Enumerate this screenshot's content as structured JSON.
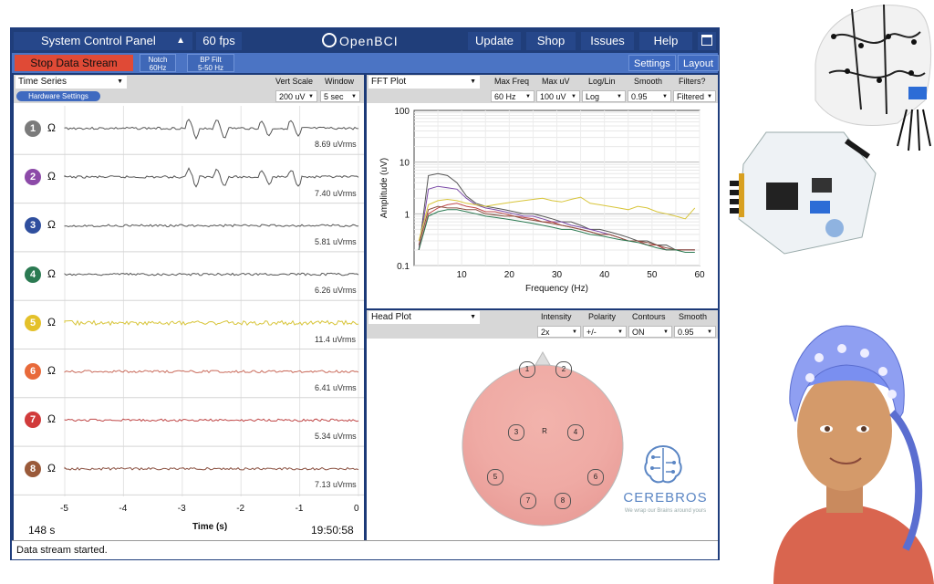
{
  "topbar": {
    "panel_label": "System Control Panel",
    "fps": "60 fps",
    "logo": "OpenBCI",
    "menu": [
      "Update",
      "Shop",
      "Issues",
      "Help"
    ]
  },
  "subbar": {
    "stop_label": "Stop Data Stream",
    "notch_l1": "Notch",
    "notch_l2": "60Hz",
    "bp_l1": "BP Filt",
    "bp_l2": "5-50 Hz",
    "settings": "Settings",
    "layout": "Layout"
  },
  "timeseries": {
    "title": "Time Series",
    "hw_settings": "Hardware Settings",
    "vert_scale_label": "Vert Scale",
    "window_label": "Window",
    "vert_scale": "200 uV",
    "window": "5 sec",
    "channels": [
      {
        "num": "1",
        "color": "#7b7b7b",
        "rms": "8.69 uVrms",
        "trace": "#555555"
      },
      {
        "num": "2",
        "color": "#8c4aa8",
        "rms": "7.40 uVrms",
        "trace": "#555555"
      },
      {
        "num": "3",
        "color": "#2f4f9e",
        "rms": "5.81 uVrms",
        "trace": "#555555"
      },
      {
        "num": "4",
        "color": "#2b7a52",
        "rms": "6.26 uVrms",
        "trace": "#555555"
      },
      {
        "num": "5",
        "color": "#e4c12a",
        "rms": "11.4 uVrms",
        "trace": "#d8c53a"
      },
      {
        "num": "6",
        "color": "#e86a3a",
        "rms": "6.41 uVrms",
        "trace": "#c96a5a"
      },
      {
        "num": "7",
        "color": "#d13b3b",
        "rms": "5.34 uVrms",
        "trace": "#c04848"
      },
      {
        "num": "8",
        "color": "#9a5a3a",
        "rms": "7.13 uVrms",
        "trace": "#8a5040"
      }
    ],
    "x_ticks": [
      "-5",
      "-4",
      "-3",
      "-2",
      "-1",
      "0"
    ],
    "x_label": "Time (s)",
    "elapsed": "148 s",
    "clock": "19:50:58"
  },
  "fft": {
    "title": "FFT Plot",
    "labels": [
      "Max Freq",
      "Max uV",
      "Log/Lin",
      "Smooth",
      "Filters?"
    ],
    "values": [
      "60 Hz",
      "100 uV",
      "Log",
      "0.95",
      "Filtered"
    ],
    "chart_data": {
      "type": "line",
      "x_label": "Frequency (Hz)",
      "y_label": "Amplitude (uV)",
      "x_ticks": [
        "10",
        "20",
        "30",
        "40",
        "50",
        "60"
      ],
      "y_ticks": [
        "100",
        "10",
        "1",
        "0.1"
      ],
      "xlim": [
        0,
        60
      ],
      "ylim": [
        0.1,
        100
      ],
      "y_scale": "log",
      "x": [
        1,
        3,
        5,
        7,
        9,
        11,
        13,
        15,
        17,
        19,
        21,
        23,
        25,
        27,
        29,
        31,
        33,
        35,
        37,
        39,
        41,
        43,
        45,
        47,
        49,
        51,
        53,
        55,
        57,
        59
      ],
      "series": [
        {
          "color": "#555555",
          "values": [
            0.2,
            5.5,
            6,
            5.5,
            4,
            2.2,
            1.6,
            1.4,
            1.3,
            1.2,
            1.1,
            1,
            1,
            0.9,
            0.8,
            0.7,
            0.7,
            0.6,
            0.5,
            0.5,
            0.45,
            0.4,
            0.35,
            0.3,
            0.3,
            0.25,
            0.25,
            0.2,
            0.2,
            0.2
          ]
        },
        {
          "color": "#7b4aa8",
          "values": [
            0.2,
            3,
            3.4,
            3.2,
            3,
            2,
            1.5,
            1.3,
            1.2,
            1.1,
            1,
            0.9,
            0.9,
            0.8,
            0.7,
            0.7,
            0.6,
            0.55,
            0.5,
            0.45,
            0.4,
            0.35,
            0.3,
            0.3,
            0.25,
            0.25,
            0.2,
            0.2,
            0.2,
            0.2
          ]
        },
        {
          "color": "#d8c53a",
          "values": [
            0.3,
            1.5,
            1.8,
            1.9,
            1.8,
            1.6,
            1.5,
            1.4,
            1.5,
            1.6,
            1.7,
            1.8,
            1.9,
            2,
            1.8,
            1.7,
            1.9,
            2.1,
            1.6,
            1.5,
            1.4,
            1.3,
            1.2,
            1.4,
            1.3,
            1.1,
            1,
            0.9,
            0.8,
            1.3
          ]
        },
        {
          "color": "#c04848",
          "values": [
            0.2,
            1,
            1.3,
            1.5,
            1.6,
            1.4,
            1.3,
            1.1,
            1.1,
            1,
            0.9,
            0.85,
            0.8,
            0.7,
            0.7,
            0.6,
            0.55,
            0.5,
            0.45,
            0.4,
            0.4,
            0.35,
            0.3,
            0.3,
            0.25,
            0.25,
            0.2,
            0.2,
            0.2,
            0.2
          ]
        },
        {
          "color": "#8a5040",
          "values": [
            0.25,
            1.2,
            1.4,
            1.3,
            1.3,
            1.2,
            1.2,
            1,
            0.95,
            0.9,
            0.9,
            0.8,
            0.75,
            0.7,
            0.65,
            0.6,
            0.55,
            0.5,
            0.45,
            0.4,
            0.4,
            0.35,
            0.3,
            0.3,
            0.28,
            0.25,
            0.22,
            0.2,
            0.2,
            0.2
          ]
        },
        {
          "color": "#2b7a52",
          "values": [
            0.2,
            0.9,
            1.1,
            1.2,
            1.2,
            1.1,
            1,
            0.9,
            0.85,
            0.8,
            0.75,
            0.7,
            0.65,
            0.6,
            0.55,
            0.5,
            0.5,
            0.45,
            0.4,
            0.38,
            0.35,
            0.32,
            0.3,
            0.28,
            0.25,
            0.22,
            0.2,
            0.2,
            0.18,
            0.18
          ]
        }
      ]
    }
  },
  "head": {
    "title": "Head Plot",
    "labels": [
      "Intensity",
      "Polarity",
      "Contours",
      "Smooth"
    ],
    "values": [
      "2x",
      "+/-",
      "ON",
      "0.95"
    ],
    "electrodes": [
      "1",
      "2",
      "3",
      "R",
      "4",
      "5",
      "6",
      "7",
      "8"
    ]
  },
  "status": "Data stream started.",
  "watermark": {
    "name": "CEREBROS",
    "tagline": "We wrap our Brains around yours"
  }
}
